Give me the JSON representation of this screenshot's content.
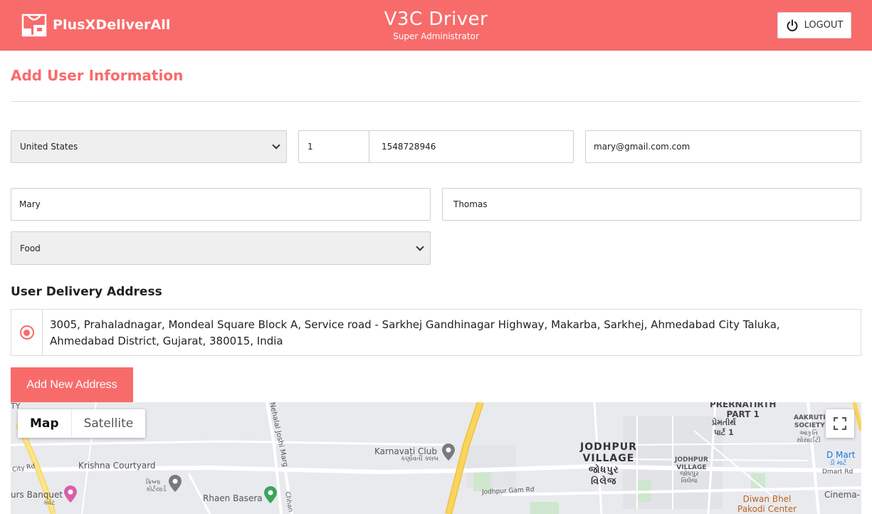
{
  "header": {
    "brand_name": "PlusXDeliverAll",
    "title": "V3C  Driver",
    "subtitle": "Super Administrator",
    "logout_label": "LOGOUT"
  },
  "form": {
    "page_title": "Add User Information",
    "country": "United States",
    "phone_code": "1",
    "phone": "1548728946",
    "email": "mary@gmail.com.com",
    "first_name": "Mary",
    "last_name": "Thomas",
    "service_type": "Food"
  },
  "address": {
    "section_title": "User Delivery Address",
    "line1": "3005, Prahaladnagar, Mondeal Square Block A, Service road - Sarkhej Gandhinagar Highway, Makarba, Sarkhej, Ahmedabad City Taluka,",
    "line2": "Ahmedabad District, Gujarat, 380015, India",
    "add_button": "Add New Address"
  },
  "map": {
    "type_map": "Map",
    "type_satellite": "Satellite",
    "labels": {
      "ty": "TY",
      "joshi_marg": "Nehalal Joshi Marg",
      "karnavati_club": "Karnavati Club",
      "karnavati_club_guj": "કર્ણાવતી ક્લબ",
      "city_rd": "City Rd",
      "krishna_courtyard": "Krishna Courtyard",
      "krishna_courtyard_guj": "ક્રિષ્ના\nકોર્ટયાર્ડ",
      "banquet": "urs Banquet",
      "banquet_guj": "ક્વેટ",
      "rhaen_basera": "Rhaen Basera",
      "chhanalal": "Chhan",
      "jodhpur_gam_rd": "Jodhpur Gam Rd",
      "jodhpur_village": "JODHPUR\nVILLAGE",
      "jodhpur_village_guj": "જોધપુર\nવિલેજ",
      "jodhpur_village_small": "JODHPUR\nVILLAGE",
      "jodhpur_village_small_guj": "જોધપુર\nવિલેજ",
      "prernatirth": "PRERNATIRTH\nPART 1",
      "prernatirth_guj": "પ્રેમતીર્થ\nપાર્ટ 1",
      "aakruti": "AAKRUTI\nSOCIETY",
      "aakruti_guj": "આકૃતિ\nસોસાઈટી",
      "dmart": "D Mart",
      "dmart_guj": "ડી માર્ટ",
      "dmart_rd": "Dmart Rd",
      "cinema": "Cinema- S",
      "diwan": "Diwan Bhel\nPakodi Center"
    }
  }
}
